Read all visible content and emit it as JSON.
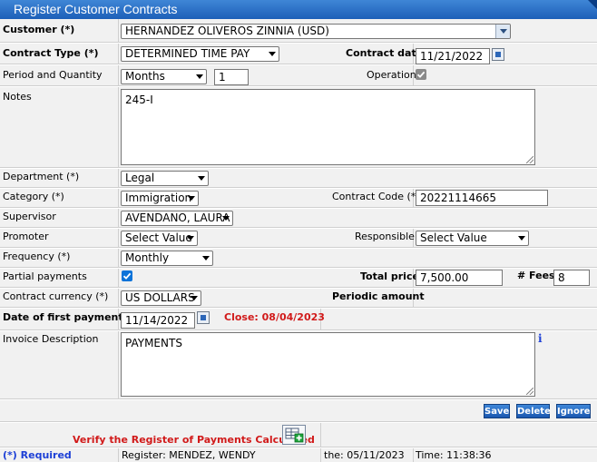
{
  "title": "Register Customer Contracts",
  "customer": {
    "label": "Customer (*)",
    "value": "HERNANDEZ OLIVEROS  ZINNIA (USD)"
  },
  "contract_type": {
    "label": "Contract Type (*)",
    "value": "DETERMINED TIME PAY"
  },
  "contract_date": {
    "label": "Contract date",
    "value": "11/21/2022"
  },
  "period": {
    "label": "Period and Quantity",
    "unit": "Months",
    "quantity": "1"
  },
  "operation": {
    "label": "Operation",
    "checked": true
  },
  "notes": {
    "label": "Notes",
    "value": "245-I"
  },
  "department": {
    "label": "Department (*)",
    "value": "Legal"
  },
  "category": {
    "label": "Category (*)",
    "value": "Immigration"
  },
  "contract_code": {
    "label": "Contract Code (*)",
    "value": "20221114665"
  },
  "supervisor": {
    "label": "Supervisor",
    "value": "AVENDANO, LAURA"
  },
  "promoter": {
    "label": "Promoter",
    "value": "Select Value"
  },
  "responsible": {
    "label": "Responsible",
    "value": "Select Value"
  },
  "frequency": {
    "label": "Frequency (*)",
    "value": "Monthly"
  },
  "partial_payments": {
    "label": "Partial payments",
    "checked": true
  },
  "total_price": {
    "label": "Total price",
    "value": "7,500.00"
  },
  "fees": {
    "label": "# Fees",
    "value": "8"
  },
  "currency": {
    "label": "Contract currency (*)",
    "value": "US DOLLARS"
  },
  "periodic_amount": {
    "label": "Periodic amount"
  },
  "first_payment": {
    "label": "Date of first payment (*)",
    "value": "11/14/2022",
    "close_text": "Close: 08/04/2023"
  },
  "invoice": {
    "label": "Invoice Description",
    "value": "PAYMENTS",
    "info": "i"
  },
  "buttons": {
    "save": "Save",
    "delete": "Delete",
    "ignore": "Ignore"
  },
  "verify_text": "Verify the Register of Payments Calculated",
  "footer": {
    "required": "(*) Required",
    "register": "Register: MENDEZ, WENDY",
    "date": "the: 05/11/2023",
    "time": "Time: 11:38:36"
  },
  "colors": {
    "header": "#1d5fb8",
    "accent": "#0b73d9",
    "alert": "#d11a1a",
    "required": "#1c3fd6"
  }
}
